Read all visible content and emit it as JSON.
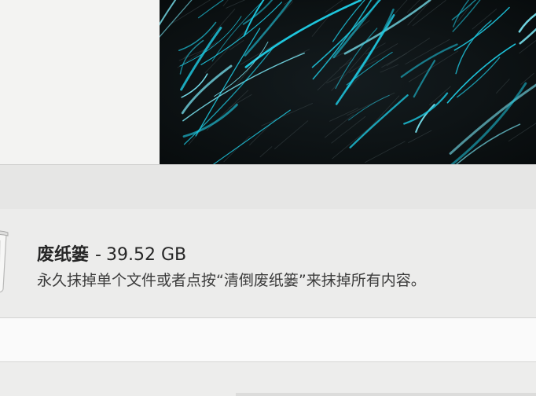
{
  "trash": {
    "name": "废纸篓",
    "separator": "-",
    "size": "39.52 GB",
    "description": "永久抹掉单个文件或者点按“清倒废纸篓”来抹掉所有内容。",
    "icon": "trash-can-icon"
  },
  "wallpaper": {
    "icon": "wallpaper-image",
    "colors": {
      "background": "#0d1214",
      "streak": "#1ec8e0",
      "streak_light": "#7be8f5"
    }
  }
}
